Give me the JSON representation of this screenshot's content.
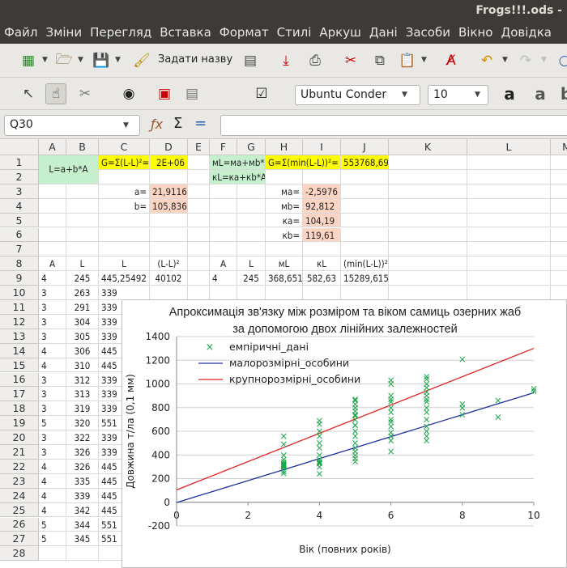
{
  "window": {
    "title": "Frogs!!!.ods -"
  },
  "menu": [
    "Файл",
    "Зміни",
    "Перегляд",
    "Вставка",
    "Формат",
    "Стилі",
    "Аркуш",
    "Дані",
    "Засоби",
    "Вікно",
    "Довідка"
  ],
  "toolbar": {
    "define_name": "Задати назву",
    "font_name": "Ubuntu Conder",
    "font_size": "10"
  },
  "formula_bar": {
    "cell_ref": "Q30",
    "fx": "ƒx",
    "sum": "Σ",
    "eq": "=",
    "content": ""
  },
  "columns": [
    "A",
    "B",
    "C",
    "D",
    "E",
    "F",
    "G",
    "H",
    "I",
    "J",
    "K",
    "L",
    "M"
  ],
  "rows": [
    "1",
    "2",
    "3",
    "4",
    "5",
    "6",
    "7",
    "8",
    "9",
    "10",
    "11",
    "12",
    "13",
    "14",
    "15",
    "16",
    "17",
    "18",
    "19",
    "20",
    "21",
    "22",
    "23",
    "24",
    "25",
    "26",
    "27",
    "28"
  ],
  "cells": {
    "model_formula": "L=a+b*A",
    "g_formula": "G=Σ(L-L)²=",
    "g_value": "2E+06",
    "small_formula": "мL=мa+мb*A",
    "large_formula": "кL=кa+кb*A",
    "g_min_formula": "G=Σ(min(L-L))²=",
    "g_min_value": "553768,69",
    "a_label": "a=",
    "a_value": "21,9116",
    "b_label": "b=",
    "b_value": "105,836",
    "sa_label": "мa=",
    "sa_value": "-2,5976",
    "sb_label": "мb=",
    "sb_value": "92,812",
    "la_label": "кa=",
    "la_value": "104,19",
    "lb_label": "кb=",
    "lb_value": "119,61",
    "headers": {
      "A": "A",
      "B": "L",
      "C": "L",
      "D": "(L-L)²",
      "F": "A",
      "G": "L",
      "H": "мL",
      "I": "кL",
      "J": "(min(L-L))²"
    },
    "row9": {
      "A": "4",
      "B": "245",
      "C": "445,25492",
      "D": "40102",
      "F": "4",
      "G": "245",
      "H": "368,651",
      "I": "582,63",
      "J": "15289,615"
    },
    "row10": {
      "A": "3",
      "B": "263",
      "C": "339"
    },
    "colA": [
      "3",
      "3",
      "3",
      "3",
      "4",
      "4",
      "3",
      "3",
      "3",
      "5",
      "3",
      "3",
      "4",
      "4",
      "4",
      "4",
      "5",
      "5"
    ],
    "colB": [
      "263",
      "291",
      "304",
      "305",
      "306",
      "310",
      "312",
      "313",
      "319",
      "320",
      "322",
      "326",
      "326",
      "335",
      "339",
      "342",
      "344",
      "345"
    ],
    "colC": [
      "339",
      "339",
      "339",
      "339",
      "445",
      "445",
      "339",
      "339",
      "339",
      "551",
      "339",
      "339",
      "445",
      "445",
      "445",
      "445",
      "551",
      "551"
    ]
  },
  "chart_data": {
    "type": "scatter",
    "title": "Апроксимація зв'язку між розміром та віком самиць озерних жаб",
    "subtitle": "за допомогою двох лінійних залежностей",
    "xlabel": "Вік (повних років)",
    "ylabel": "Довжина т/ла (0,1 мм)",
    "xlim": [
      0,
      10
    ],
    "ylim": [
      -200,
      1400
    ],
    "xticks": [
      0,
      2,
      4,
      6,
      8,
      10
    ],
    "yticks": [
      -200,
      0,
      200,
      400,
      600,
      800,
      1000,
      1200,
      1400
    ],
    "legend_position": "top-left",
    "series": [
      {
        "name": "емпіричні_дані",
        "kind": "points",
        "color": "#1aa84a",
        "x": [
          3,
          3,
          3,
          3,
          3,
          3,
          3,
          3,
          3,
          3,
          3,
          3,
          3,
          3,
          3,
          3,
          4,
          4,
          4,
          4,
          4,
          4,
          4,
          4,
          4,
          4,
          4,
          4,
          4,
          4,
          5,
          5,
          5,
          5,
          5,
          5,
          5,
          5,
          5,
          5,
          5,
          5,
          5,
          5,
          5,
          5,
          5,
          5,
          6,
          6,
          6,
          6,
          6,
          6,
          6,
          6,
          6,
          6,
          6,
          6,
          6,
          6,
          7,
          7,
          7,
          7,
          7,
          7,
          7,
          7,
          7,
          7,
          7,
          7,
          7,
          7,
          7,
          8,
          8,
          8,
          8,
          9,
          9,
          10,
          10
        ],
        "y": [
          245,
          263,
          291,
          304,
          305,
          310,
          312,
          313,
          319,
          322,
          326,
          339,
          360,
          400,
          490,
          560,
          240,
          300,
          326,
          335,
          339,
          342,
          360,
          400,
          460,
          500,
          560,
          600,
          660,
          690,
          345,
          370,
          400,
          430,
          460,
          500,
          560,
          600,
          650,
          700,
          740,
          770,
          800,
          830,
          860,
          870,
          730,
          650,
          430,
          520,
          560,
          590,
          640,
          680,
          700,
          760,
          800,
          850,
          870,
          900,
          1000,
          1030,
          520,
          560,
          600,
          640,
          700,
          760,
          800,
          850,
          870,
          900,
          930,
          970,
          1000,
          1040,
          1060,
          740,
          800,
          830,
          1210,
          860,
          720,
          940,
          960
        ]
      },
      {
        "name": "малорозмірні_особини",
        "kind": "line",
        "color": "#1f2f9e",
        "intercept": -2.5976,
        "slope": 92.812
      },
      {
        "name": "крупнорозмірні_особини",
        "kind": "line",
        "color": "#e02020",
        "intercept": 104.19,
        "slope": 119.61
      }
    ]
  }
}
